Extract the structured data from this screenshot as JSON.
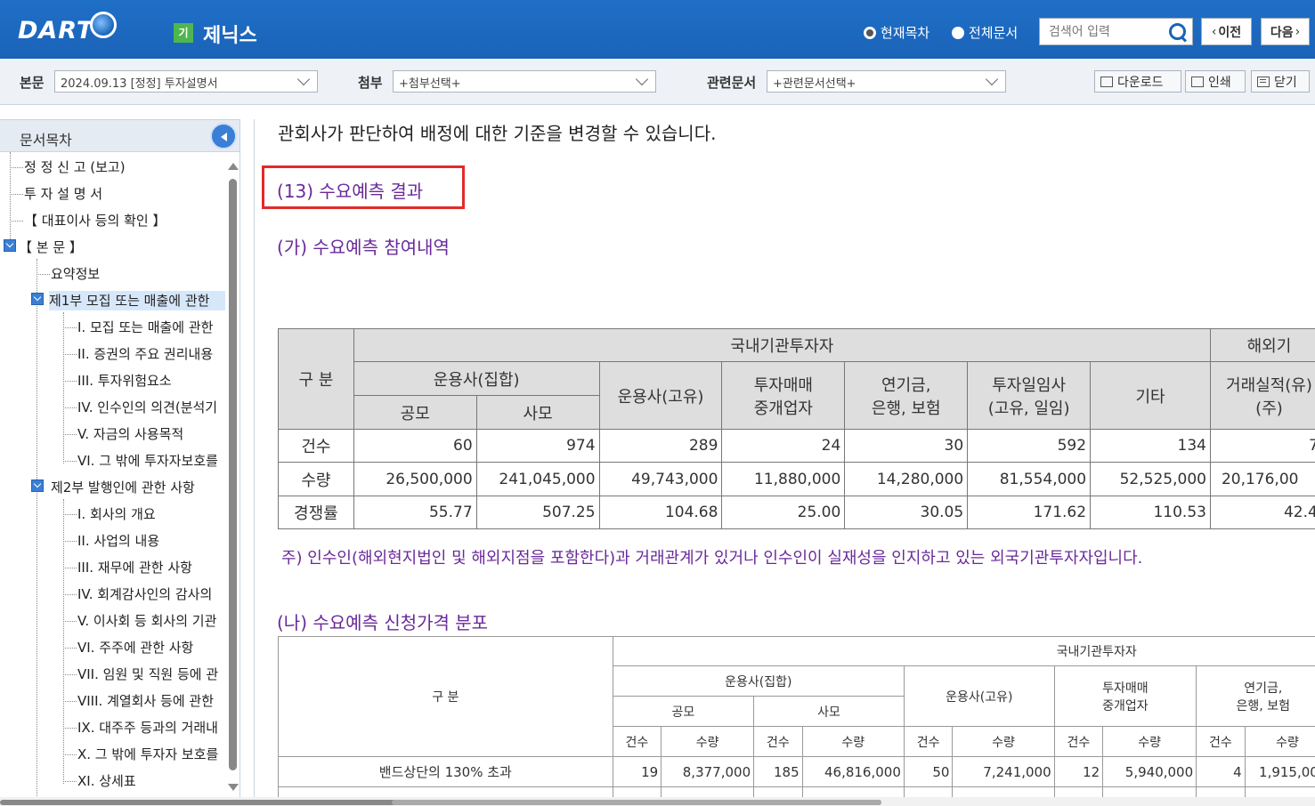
{
  "header": {
    "logo": "DART",
    "corp_badge": "기",
    "corp_name": "제닉스",
    "radio_current": "현재목차",
    "radio_all": "전체문서",
    "search_placeholder": "검색어 입력",
    "prev_label": "이전",
    "next_label": "다음"
  },
  "subbar": {
    "body_label": "본문",
    "body_select": "2024.09.13  [정정] 투자설명서",
    "attach_label": "첨부",
    "attach_select": "+첨부선택+",
    "related_label": "관련문서",
    "related_select": "+관련문서선택+",
    "download": "다운로드",
    "print": "인쇄",
    "close": "닫기"
  },
  "sidebar": {
    "title": "문서목차",
    "items": [
      "정 정 신 고 (보고)",
      "투 자 설 명 서",
      "【 대표이사 등의 확인 】",
      "【 본 문 】",
      "요약정보",
      "제1부 모집 또는 매출에 관한",
      "I. 모집 또는 매출에 관한",
      "II. 증권의 주요 권리내용",
      "III. 투자위험요소",
      "IV. 인수인의 의견(분석기",
      "V. 자금의 사용목적",
      "VI. 그 밖에 투자자보호를",
      "제2부 발행인에 관한 사항",
      "I. 회사의 개요",
      "II. 사업의 내용",
      "III. 재무에 관한 사항",
      "IV. 회계감사인의 감사의",
      "V. 이사회 등 회사의 기관",
      "VI. 주주에 관한 사항",
      "VII. 임원 및 직원 등에 관",
      "VIII. 계열회사 등에 관한",
      "IX. 대주주 등과의 거래내",
      "X. 그 밖에 투자자 보호를",
      "XI. 상세표"
    ]
  },
  "content": {
    "intro_line": "관회사가 판단하여 배정에 대한 기준을 변경할 수 있습니다.",
    "section13": "(13) 수요예측 결과",
    "section_ga": "(가) 수요예측 참여내역",
    "section_na": "(나) 수요예측 신청가격 분포",
    "note": "주)   인수인(해외현지법인 및 해외지점을 포함한다)과 거래관계가 있거나 인수인이 실재성을 인지하고 있는 외국기관투자자입니다.",
    "table1": {
      "gubun": "구 분",
      "domestic": "국내기관투자자",
      "foreign": "해외기",
      "col_unyong_jiphap": "운용사(집합)",
      "col_gongmo": "공모",
      "col_samo": "사모",
      "col_unyong_goyu": "운용사(고유)",
      "col_tuja_l1": "투자매매",
      "col_tuja_l2": "중개업자",
      "col_yeongeum_l1": "연기금,",
      "col_yeongeum_l2": "은행, 보험",
      "col_ilim_l1": "투자일임사",
      "col_ilim_l2": "(고유, 일임)",
      "col_gita": "기타",
      "col_foreign_l1": "거래실적(유)",
      "col_foreign_l2": "(주)",
      "rows": [
        {
          "label": "건수",
          "values": [
            "60",
            "974",
            "289",
            "24",
            "30",
            "592",
            "134",
            "7"
          ]
        },
        {
          "label": "수량",
          "values": [
            "26,500,000",
            "241,045,000",
            "49,743,000",
            "11,880,000",
            "14,280,000",
            "81,554,000",
            "52,525,000",
            "20,176,00"
          ]
        },
        {
          "label": "경쟁률",
          "values": [
            "55.77",
            "507.25",
            "104.68",
            "25.00",
            "30.05",
            "171.62",
            "110.53",
            "42.4"
          ]
        }
      ]
    },
    "table2": {
      "gubun": "구 분",
      "domestic": "국내기관투자자",
      "col_unyong_jiphap": "운용사(집합)",
      "col_gongmo": "공모",
      "col_samo": "사모",
      "col_unyong_goyu": "운용사(고유)",
      "col_tuja_l1": "투자매매",
      "col_tuja_l2": "중개업자",
      "col_yeongeum_l1": "연기금,",
      "col_yeongeum_l2": "은행, 보험",
      "count": "건수",
      "qty": "수량",
      "last_partial": "건",
      "row1_label": "밴드상단의 130% 초과",
      "row1_values": [
        "19",
        "8,377,000",
        "185",
        "46,816,000",
        "50",
        "7,241,000",
        "12",
        "5,940,000",
        "4",
        "1,915,000"
      ]
    }
  }
}
